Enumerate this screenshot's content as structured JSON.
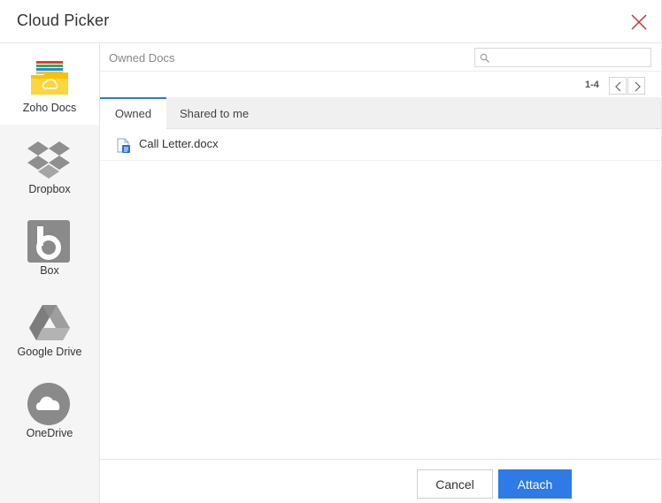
{
  "dialog": {
    "title": "Cloud Picker"
  },
  "sidebar": {
    "providers": [
      {
        "label": "Zoho Docs",
        "icon": "zoho-docs-folder-icon",
        "active": true
      },
      {
        "label": "Dropbox",
        "icon": "dropbox-icon",
        "active": false
      },
      {
        "label": "Box",
        "icon": "box-icon",
        "active": false
      },
      {
        "label": "Google Drive",
        "icon": "google-drive-icon",
        "active": false
      },
      {
        "label": "OneDrive",
        "icon": "onedrive-icon",
        "active": false
      }
    ]
  },
  "main": {
    "breadcrumb": "Owned Docs",
    "search": {
      "value": "",
      "placeholder": ""
    },
    "pager": {
      "range": "1-4"
    },
    "tabs": [
      {
        "label": "Owned",
        "active": true
      },
      {
        "label": "Shared to me",
        "active": false
      }
    ],
    "files": [
      {
        "name": "Call Letter.docx",
        "icon": "docx-file-icon"
      }
    ]
  },
  "footer": {
    "cancel_label": "Cancel",
    "attach_label": "Attach"
  },
  "colors": {
    "accent": "#2e7ae6",
    "tab_underline": "#2f7ad9",
    "close_icon": "#c0392b"
  }
}
